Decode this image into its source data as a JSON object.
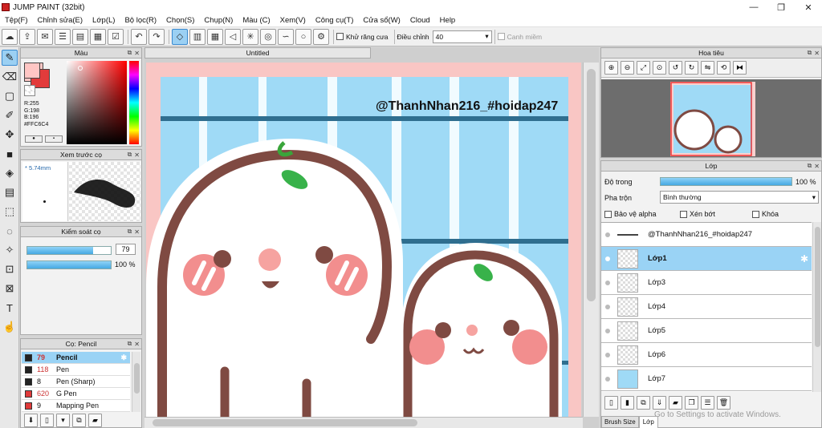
{
  "app": {
    "title": "JUMP PAINT (32bit)"
  },
  "window_controls": [
    "—",
    "❐",
    "✕"
  ],
  "menu": [
    "Tệp(F)",
    "Chỉnh sửa(E)",
    "Lớp(L)",
    "Bộ lọc(R)",
    "Chọn(S)",
    "Chụp(N)",
    "Màu (C)",
    "Xem(V)",
    "Công cụ(T)",
    "Cửa sổ(W)",
    "Cloud",
    "Help"
  ],
  "toolbar": {
    "antialias_label": "Khử răng cưa",
    "adjust_label": "Điều chỉnh",
    "adjust_value": "40",
    "margin_label": "Canh miềm"
  },
  "color_panel": {
    "title": "Màu",
    "r": "R:255",
    "g": "G:198",
    "b": "B:196",
    "hex": "#FFC6C4",
    "primary_color": "#FFC6C4"
  },
  "brush_preview": {
    "title": "Xem trước cọ",
    "size": "* 5.74mm"
  },
  "brush_control": {
    "title": "Kiểm soát cọ",
    "size_value": "79",
    "opacity_value": "100 %",
    "size_fraction": 0.79,
    "opacity_fraction": 1.0
  },
  "brush_list": {
    "title": "Cọ: Pencil",
    "items": [
      {
        "size": "79",
        "name": "Pencil",
        "color": "#222222"
      },
      {
        "size": "118",
        "name": "Pen",
        "color": "#222222"
      },
      {
        "size": "8",
        "name": "Pen (Sharp)",
        "color": "#222222"
      },
      {
        "size": "620",
        "name": "G Pen",
        "color": "#e03a3a"
      },
      {
        "size": "9",
        "name": "Mapping Pen",
        "color": "#e03a3a"
      }
    ]
  },
  "document": {
    "tab_title": "Untitled",
    "watermark_text": "@ThanhNhan216_#hoidap247"
  },
  "navigator": {
    "title": "Hoa tiêu"
  },
  "layers_panel": {
    "title": "Lớp",
    "opacity_label": "Độ trong",
    "opacity_value": "100 %",
    "opacity_fraction": 1.0,
    "blend_label": "Pha trộn",
    "blend_value": "Bình thường",
    "protect_alpha": "Bảo vệ alpha",
    "clip": "Xén bớt",
    "lock": "Khóa",
    "layers": [
      {
        "name": "@ThanhNhan216_#hoidap247"
      },
      {
        "name": "Lớp1"
      },
      {
        "name": "Lớp3"
      },
      {
        "name": "Lớp4"
      },
      {
        "name": "Lớp5"
      },
      {
        "name": "Lớp6"
      },
      {
        "name": "Lớp7"
      }
    ]
  },
  "bottom_tabs": [
    "Brush Size",
    "Lớp"
  ],
  "os_watermark": "Go to Settings to activate Windows."
}
